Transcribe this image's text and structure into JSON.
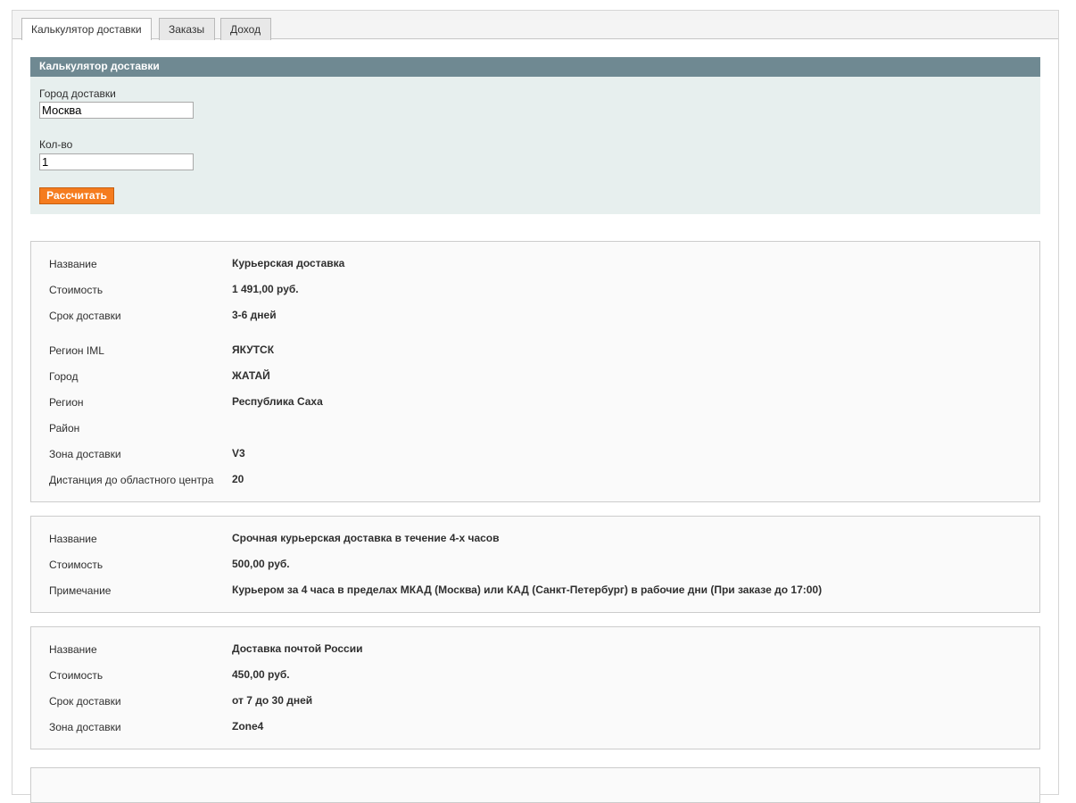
{
  "tabs": [
    {
      "label": "Калькулятор доставки"
    },
    {
      "label": "Заказы"
    },
    {
      "label": "Доход"
    }
  ],
  "calculator": {
    "title": "Калькулятор доставки",
    "city_label": "Город доставки",
    "city_value": "Москва",
    "qty_label": "Кол-во",
    "qty_value": "1",
    "submit_label": "Рассчитать"
  },
  "results": [
    {
      "rows": [
        {
          "label": "Название",
          "value": "Курьерская доставка"
        },
        {
          "label": "Стоимость",
          "value": "1 491,00 руб."
        },
        {
          "label": "Срок доставки",
          "value": "3-6 дней"
        },
        {
          "label": "Регион IML",
          "value": "ЯКУТСК"
        },
        {
          "label": "Город",
          "value": "ЖАТАЙ"
        },
        {
          "label": "Регион",
          "value": "Республика Саха"
        },
        {
          "label": "Район",
          "value": ""
        },
        {
          "label": "Зона доставки",
          "value": "V3"
        },
        {
          "label": "Дистанция до областного центра",
          "value": "20"
        }
      ]
    },
    {
      "rows": [
        {
          "label": "Название",
          "value": "Срочная курьерская доставка в течение 4-х часов"
        },
        {
          "label": "Стоимость",
          "value": "500,00 руб."
        },
        {
          "label": "Примечание",
          "value": "Курьером за 4 часа в пределах МКАД (Москва) или КАД (Санкт-Петербург) в рабочие дни (При заказе до 17:00)"
        }
      ]
    },
    {
      "rows": [
        {
          "label": "Название",
          "value": "Доставка почтой России"
        },
        {
          "label": "Стоимость",
          "value": "450,00 руб."
        },
        {
          "label": "Срок доставки",
          "value": "от 7 до 30 дней"
        },
        {
          "label": "Зона доставки",
          "value": "Zone4"
        }
      ]
    }
  ],
  "colors": {
    "header_bar": "#6f8992",
    "form_bg": "#e7efee",
    "button": "#f57c1f"
  }
}
